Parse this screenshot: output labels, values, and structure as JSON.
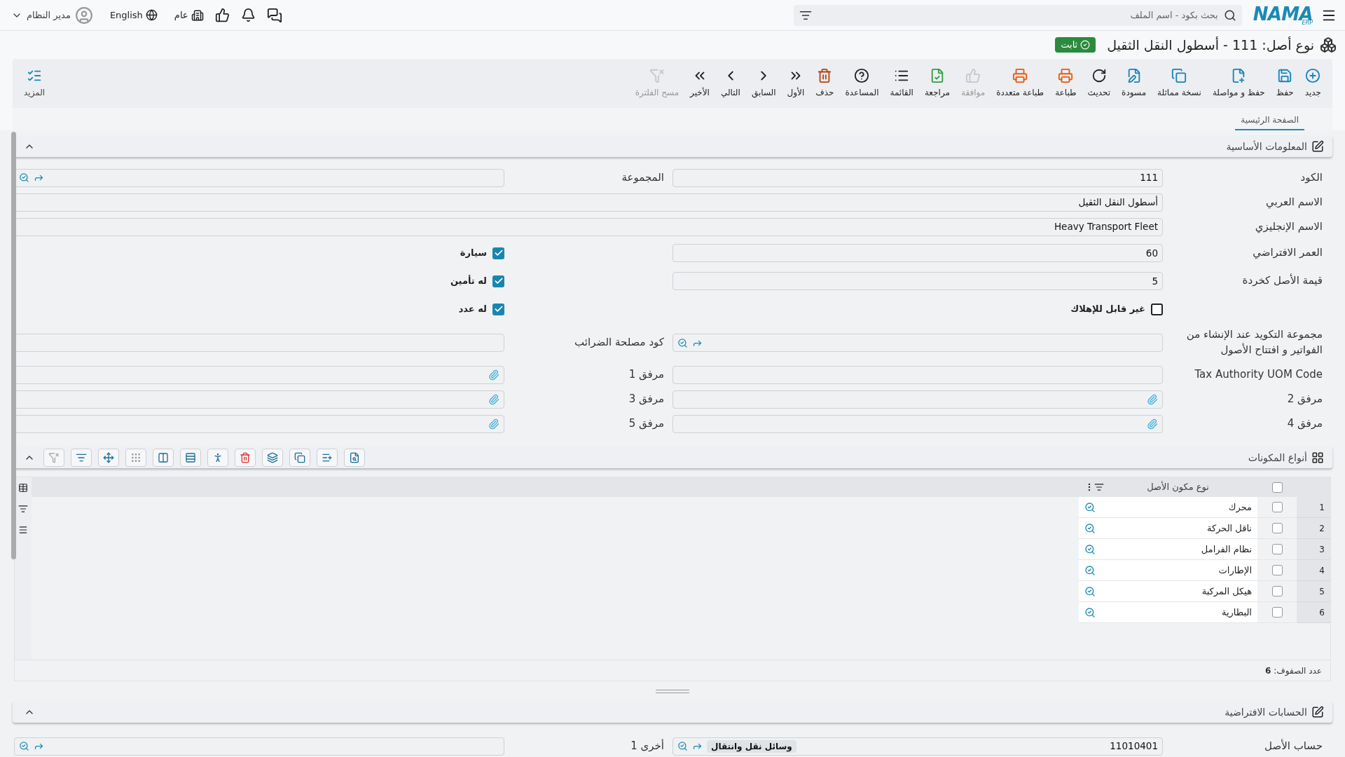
{
  "topbar": {
    "logo": "NAMA",
    "logo_sub": "ERP",
    "search": {
      "placeholder": "بحث بكود - اسم الملف"
    },
    "company": "عام",
    "language": "English",
    "user": "مدير النظام"
  },
  "title": {
    "text": "نوع أصل: 111 - أسطول النقل الثقيل",
    "status": "ثابت"
  },
  "toolbar": {
    "items": [
      {
        "kind": "new",
        "label": "جديد",
        "disabled": false
      },
      {
        "kind": "save",
        "label": "حفظ",
        "disabled": false
      },
      {
        "kind": "save-continue",
        "label": "حفظ و مواصلة",
        "disabled": false
      },
      {
        "kind": "duplicate",
        "label": "نسخة مماثلة",
        "disabled": false
      },
      {
        "kind": "draft",
        "label": "مسودة",
        "disabled": false
      },
      {
        "kind": "refresh",
        "label": "تحديث",
        "disabled": false
      },
      {
        "kind": "print",
        "label": "طباعة",
        "disabled": false
      },
      {
        "kind": "multi-print",
        "label": "طباعة متعددة",
        "disabled": false
      },
      {
        "kind": "approve",
        "label": "موافقة",
        "disabled": true
      },
      {
        "kind": "review",
        "label": "مراجعة",
        "disabled": false
      },
      {
        "kind": "list",
        "label": "القائمة",
        "disabled": false
      },
      {
        "kind": "help",
        "label": "المساعدة",
        "disabled": false
      },
      {
        "kind": "delete",
        "label": "حذف",
        "disabled": false
      },
      {
        "kind": "first",
        "label": "الأول",
        "disabled": false
      },
      {
        "kind": "previous",
        "label": "السابق",
        "disabled": false
      },
      {
        "kind": "next",
        "label": "التالي",
        "disabled": false
      },
      {
        "kind": "last",
        "label": "الأخير",
        "disabled": false
      },
      {
        "kind": "clear-filter",
        "label": "مسح الفلترة",
        "disabled": true
      }
    ],
    "more": "المزيد"
  },
  "tabs": [
    {
      "label": "الصفحة الرئيسية",
      "selected": true
    }
  ],
  "basic_info": {
    "title": "المعلومات الأساسية",
    "expanded": true,
    "rows": [
      [
        {
          "kind": "text",
          "label": "الكود",
          "value": "111"
        },
        {
          "kind": "lookup",
          "label": "المجموعة"
        }
      ],
      [
        {
          "kind": "text",
          "label": "الاسم العربي",
          "value": "أسطول النقل الثقيل"
        }
      ],
      [
        {
          "kind": "text",
          "label": "الاسم الإنجليزي",
          "value": "Heavy Transport Fleet"
        }
      ],
      [
        {
          "kind": "text",
          "label": "العمر الافتراضي",
          "value": "60"
        },
        {
          "kind": "checkbox",
          "label": "سيارة",
          "checked": true
        }
      ],
      [
        {
          "kind": "text",
          "label": "قيمة الأصل كخردة",
          "value": "5"
        },
        {
          "kind": "checkbox",
          "label": "له تأمين",
          "checked": true
        }
      ],
      [
        {
          "kind": "checkbox",
          "label": "غير قابل للإهلاك",
          "checked": false
        },
        {
          "kind": "checkbox",
          "label": "له عدد",
          "checked": true
        }
      ],
      [
        {
          "kind": "lookup",
          "label": "مجموعة التكويد عند الإنشاء من الفواتير و افتتاح الأصول"
        },
        {
          "kind": "text",
          "label": "كود مصلحة الضرائب"
        }
      ],
      [
        {
          "kind": "text",
          "label": "Tax Authority UOM Code"
        },
        {
          "kind": "attachment",
          "label": "مرفق 1"
        }
      ],
      [
        {
          "kind": "attachment",
          "label": "مرفق 2"
        },
        {
          "kind": "attachment",
          "label": "مرفق 3"
        }
      ],
      [
        {
          "kind": "attachment",
          "label": "مرفق 4"
        },
        {
          "kind": "attachment",
          "label": "مرفق 5"
        }
      ]
    ]
  },
  "components": {
    "title": "أنواع المكونات",
    "expanded": true,
    "column": "نوع مكون الأصل",
    "all_checked": false,
    "rows": [
      {
        "number": "1",
        "name": "محرك",
        "checked": false
      },
      {
        "number": "2",
        "name": "ناقل الحركة",
        "checked": false
      },
      {
        "number": "3",
        "name": "نظام الفرامل",
        "checked": false
      },
      {
        "number": "4",
        "name": "الإطارات",
        "checked": false
      },
      {
        "number": "5",
        "name": "هيكل المركبة",
        "checked": false
      },
      {
        "number": "6",
        "name": "البطارية",
        "checked": false
      }
    ],
    "row_count": "عدد الصفوف: **6**"
  },
  "accounts": {
    "title": "الحسابات الافتراضية",
    "expanded": true,
    "rows": [
      [
        {
          "kind": "lookup",
          "label": "حساب الأصل",
          "value": "11010401",
          "tag": "وسائل نقل وانتقال"
        },
        {
          "kind": "lookup",
          "label": "أخرى 1"
        }
      ]
    ]
  }
}
